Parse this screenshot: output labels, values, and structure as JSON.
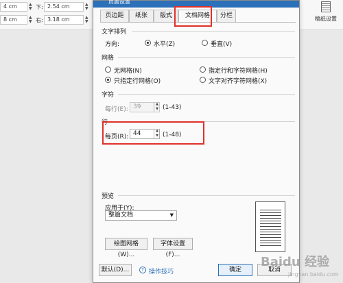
{
  "background": {
    "left_fields": [
      {
        "value": "4 cm"
      },
      {
        "value": "8 cm"
      }
    ],
    "right_fields": [
      {
        "label": "下:",
        "value": "2.54 cm"
      },
      {
        "label": "右:",
        "value": "3.18 cm"
      }
    ],
    "gallery_label": "稿纸设置"
  },
  "dialog": {
    "title": "页面设置",
    "tabs": [
      "页边距",
      "纸张",
      "版式",
      "文档网格",
      "分栏"
    ],
    "active_tab": "文档网格",
    "text_direction": {
      "title": "文字排列",
      "direction_label": "方向:",
      "horizontal": "水平(Z)",
      "vertical": "垂直(V)",
      "selected": "水平(Z)"
    },
    "grid": {
      "title": "网格",
      "options": [
        "无网格(N)",
        "指定行和字符网格(H)",
        "只指定行网格(O)",
        "文字对齐字符网格(X)"
      ],
      "selected": "只指定行网格(O)"
    },
    "chars": {
      "title": "字符",
      "per_line_label": "每行(E):",
      "per_line_value": "39",
      "range": "(1-43)"
    },
    "lines": {
      "title": "行",
      "per_page_label": "每页(R):",
      "per_page_value": "44",
      "range": "(1-48)"
    },
    "preview": {
      "title": "预览",
      "apply_label": "应用于(Y):",
      "apply_value": "整篇文档",
      "draw_grid_button": "绘图网格(W)...",
      "font_settings_button": "字体设置(F)..."
    },
    "footer": {
      "default_button": "默认(D)...",
      "tips_link": "操作技巧",
      "ok_button": "确定",
      "cancel_button": "取消"
    }
  },
  "watermark": {
    "text": "Baidu 经验",
    "sub": "jingyan.baidu.com"
  },
  "colors": {
    "accent": "#2b70b8",
    "highlight": "#e0302a"
  }
}
